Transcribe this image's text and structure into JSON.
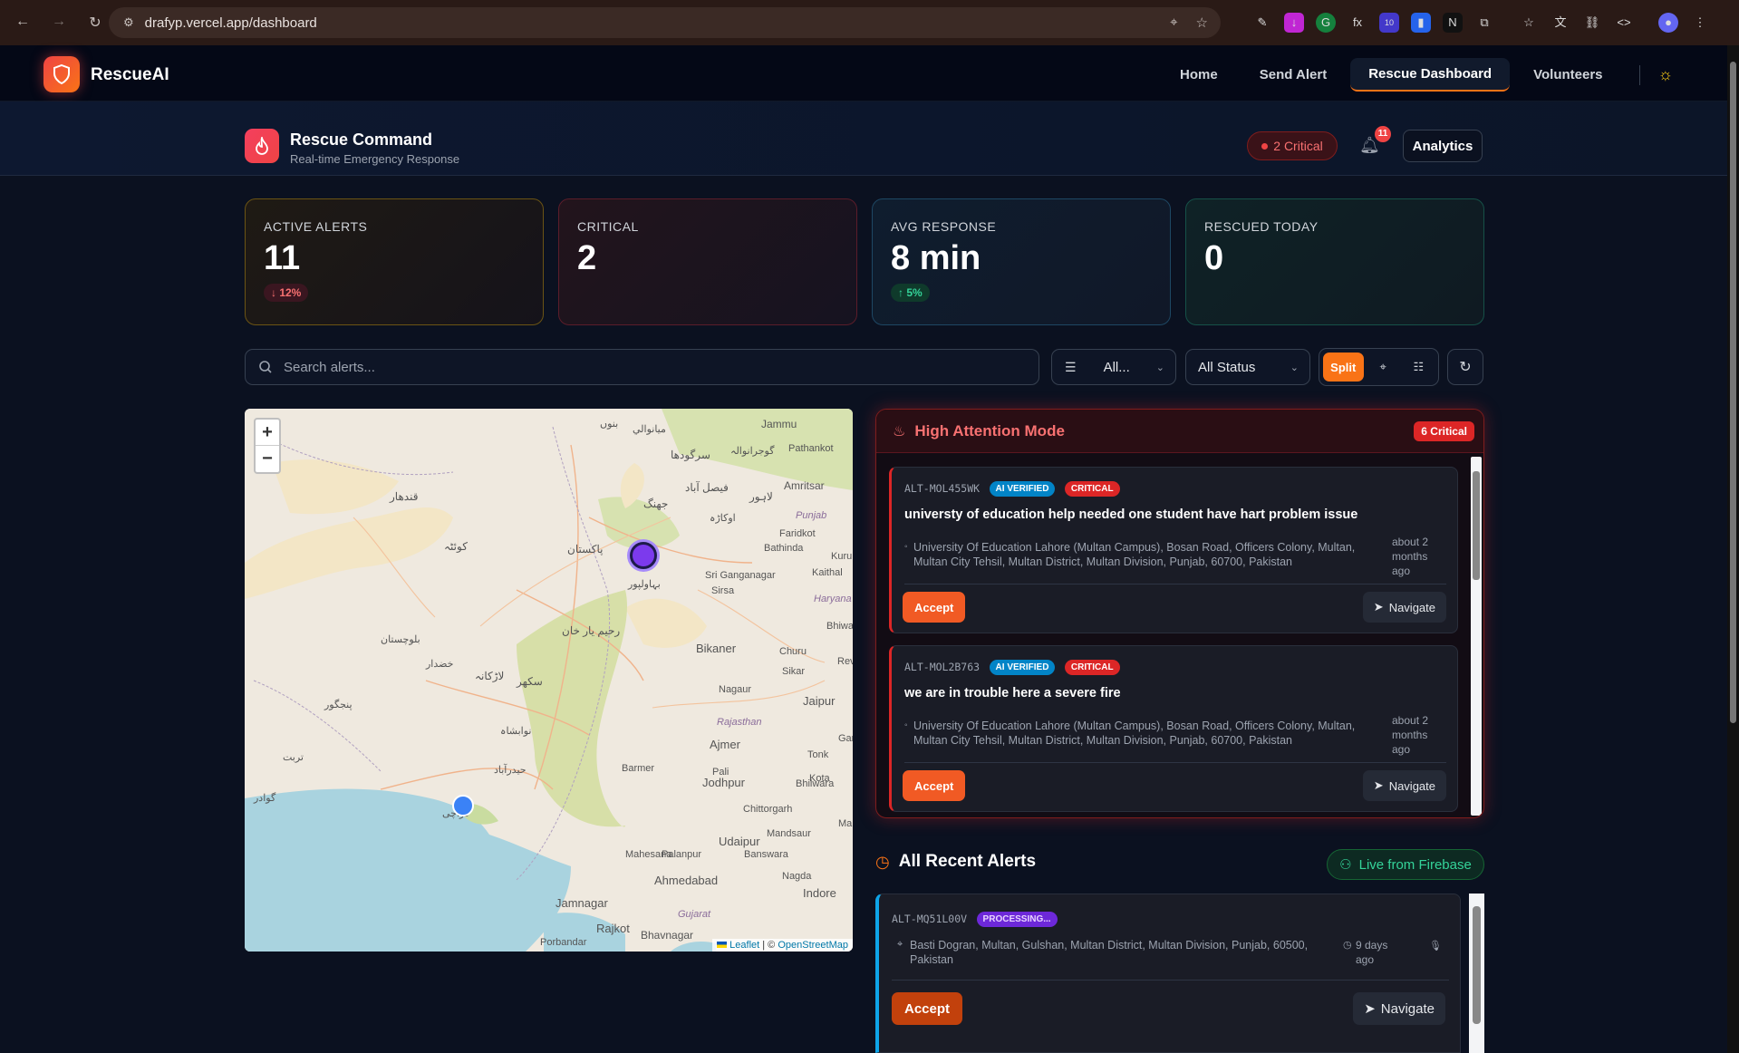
{
  "browser": {
    "url": "drafyp.vercel.app/dashboard",
    "ext_badge": "10"
  },
  "header": {
    "brand": "RescueAI",
    "nav": [
      {
        "label": "Home"
      },
      {
        "label": "Send Alert"
      },
      {
        "label": "Rescue Dashboard",
        "active": true
      },
      {
        "label": "Volunteers"
      }
    ]
  },
  "command": {
    "title": "Rescue Command",
    "subtitle": "Real-time Emergency Response",
    "critical_pill": "2 Critical",
    "notifications": "11",
    "analytics": "Analytics"
  },
  "stats": [
    {
      "label": "ACTIVE ALERTS",
      "value": "11",
      "delta": "↓ 12%",
      "color": "#f59e0b"
    },
    {
      "label": "CRITICAL",
      "value": "2",
      "delta": "",
      "color": "#ef4444"
    },
    {
      "label": "AVG RESPONSE",
      "value": "8 min",
      "delta": "↑ 5%",
      "color": "#0ea5e9"
    },
    {
      "label": "RESCUED TODAY",
      "value": "0",
      "delta": "",
      "color": "#10b981"
    }
  ],
  "toolbar": {
    "search_placeholder": "Search alerts...",
    "type_filter": "All...",
    "status_filter": "All Status",
    "view_split": "Split"
  },
  "map": {
    "zoom_in": "+",
    "zoom_out": "−",
    "attribution_leaflet": "Leaflet",
    "attribution_sep": " | © ",
    "attribution_osm": "OpenStreetMap",
    "labels": [
      "Jammu",
      "Pathankot",
      "Amritsar",
      "Bathinda",
      "Sri Ganganagar",
      "Kaithal",
      "Bikaner",
      "Churu",
      "Sikar",
      "Jaipur",
      "Nagaur",
      "Ajmer",
      "Jodhpur",
      "Tonk",
      "Pali",
      "Bhilwara",
      "Kota",
      "Barmer",
      "Chittorgarh",
      "Udaipur",
      "Palanpur",
      "Mandsaur",
      "Banswara",
      "Mahesana",
      "Ahmedabad",
      "Nagda",
      "Indore",
      "Jamnagar",
      "Rajkot",
      "Bhavnagar",
      "Porbandar",
      "Sirsa",
      "Faridkot",
      "Bhiwani",
      "Haryana",
      "Punjab",
      "Rajasthan",
      "Gujarat",
      "Kuru",
      "Revi",
      "Gan",
      "Ma"
    ],
    "urdu_labels": [
      "بنوں",
      "ميانوالي",
      "سرگودھا",
      "گوجرانوالہ",
      "فيصل آباد",
      "جھنگ",
      "لاہور",
      "اوکاڑہ",
      "پاکستان",
      "بہاولپور",
      "رحیم یار خان",
      "سکھر",
      "لاڑکانہ",
      "نوابشاہ",
      "حیدرآباد",
      "کراچی",
      "کوئٹہ",
      "قندھار",
      "گوادر",
      "تربت",
      "پنجگور",
      "خضدار",
      "بلوچستان"
    ]
  },
  "high_attention": {
    "title": "High Attention Mode",
    "count_badge": "6 Critical",
    "alerts": [
      {
        "id": "ALT-MOL455WK",
        "tag_ai": "AI VERIFIED",
        "tag_level": "CRITICAL",
        "message": "universty of education help needed one student have hart problem issue",
        "location": "University Of Education Lahore (Multan Campus), Bosan Road, Officers Colony, Multan, Multan City Tehsil, Multan District, Multan Division, Punjab, 60700, Pakistan",
        "ago": "about 2 months ago",
        "accept": "Accept",
        "navigate": "Navigate"
      },
      {
        "id": "ALT-MOL2B763",
        "tag_ai": "AI VERIFIED",
        "tag_level": "CRITICAL",
        "message": "we are in trouble here a severe fire",
        "location": "University Of Education Lahore (Multan Campus), Bosan Road, Officers Colony, Multan, Multan City Tehsil, Multan District, Multan Division, Punjab, 60700, Pakistan",
        "ago": "about 2 months ago",
        "accept": "Accept",
        "navigate": "Navigate"
      }
    ]
  },
  "recent": {
    "title": "All Recent Alerts",
    "live": "Live from Firebase",
    "alerts": [
      {
        "id": "ALT-MQ51L00V",
        "tag": "PROCESSING...",
        "location": "Basti Dogran, Multan, Gulshan, Multan District, Multan Division, Punjab, 60500, Pakistan",
        "ago": "9 days ago",
        "accept": "Accept",
        "navigate": "Navigate"
      }
    ]
  }
}
